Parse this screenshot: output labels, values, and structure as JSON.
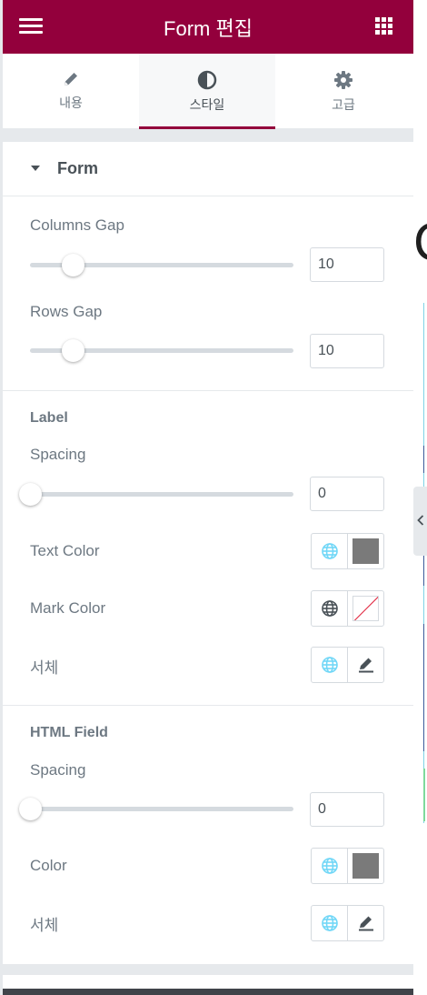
{
  "header": {
    "title": "Form 편집",
    "menu_icon": "hamburger-icon",
    "apps_icon": "grid-icon"
  },
  "tabs": [
    {
      "label": "내용",
      "icon": "pencil-icon",
      "active": false
    },
    {
      "label": "스타일",
      "icon": "contrast-icon",
      "active": true
    },
    {
      "label": "고급",
      "icon": "gear-icon",
      "active": false
    }
  ],
  "section": {
    "title": "Form",
    "expanded": true
  },
  "form": {
    "columns_gap": {
      "label": "Columns Gap",
      "value": "10"
    },
    "rows_gap": {
      "label": "Rows Gap",
      "value": "10"
    }
  },
  "label": {
    "heading": "Label",
    "spacing": {
      "label": "Spacing",
      "value": "0"
    },
    "text_color": {
      "label": "Text Color",
      "color": "#7a7a7a"
    },
    "mark_color": {
      "label": "Mark Color",
      "color": "none"
    },
    "typography": {
      "label": "서체"
    }
  },
  "html_field": {
    "heading": "HTML Field",
    "spacing": {
      "label": "Spacing",
      "value": "0"
    },
    "color": {
      "label": "Color",
      "color": "#7a7a7a"
    },
    "typography": {
      "label": "서체"
    }
  },
  "preview": {
    "heading_fragment": "C"
  },
  "colors": {
    "brand": "#93003c",
    "globe_active": "#71d7f7",
    "globe_inactive": "#495157"
  }
}
